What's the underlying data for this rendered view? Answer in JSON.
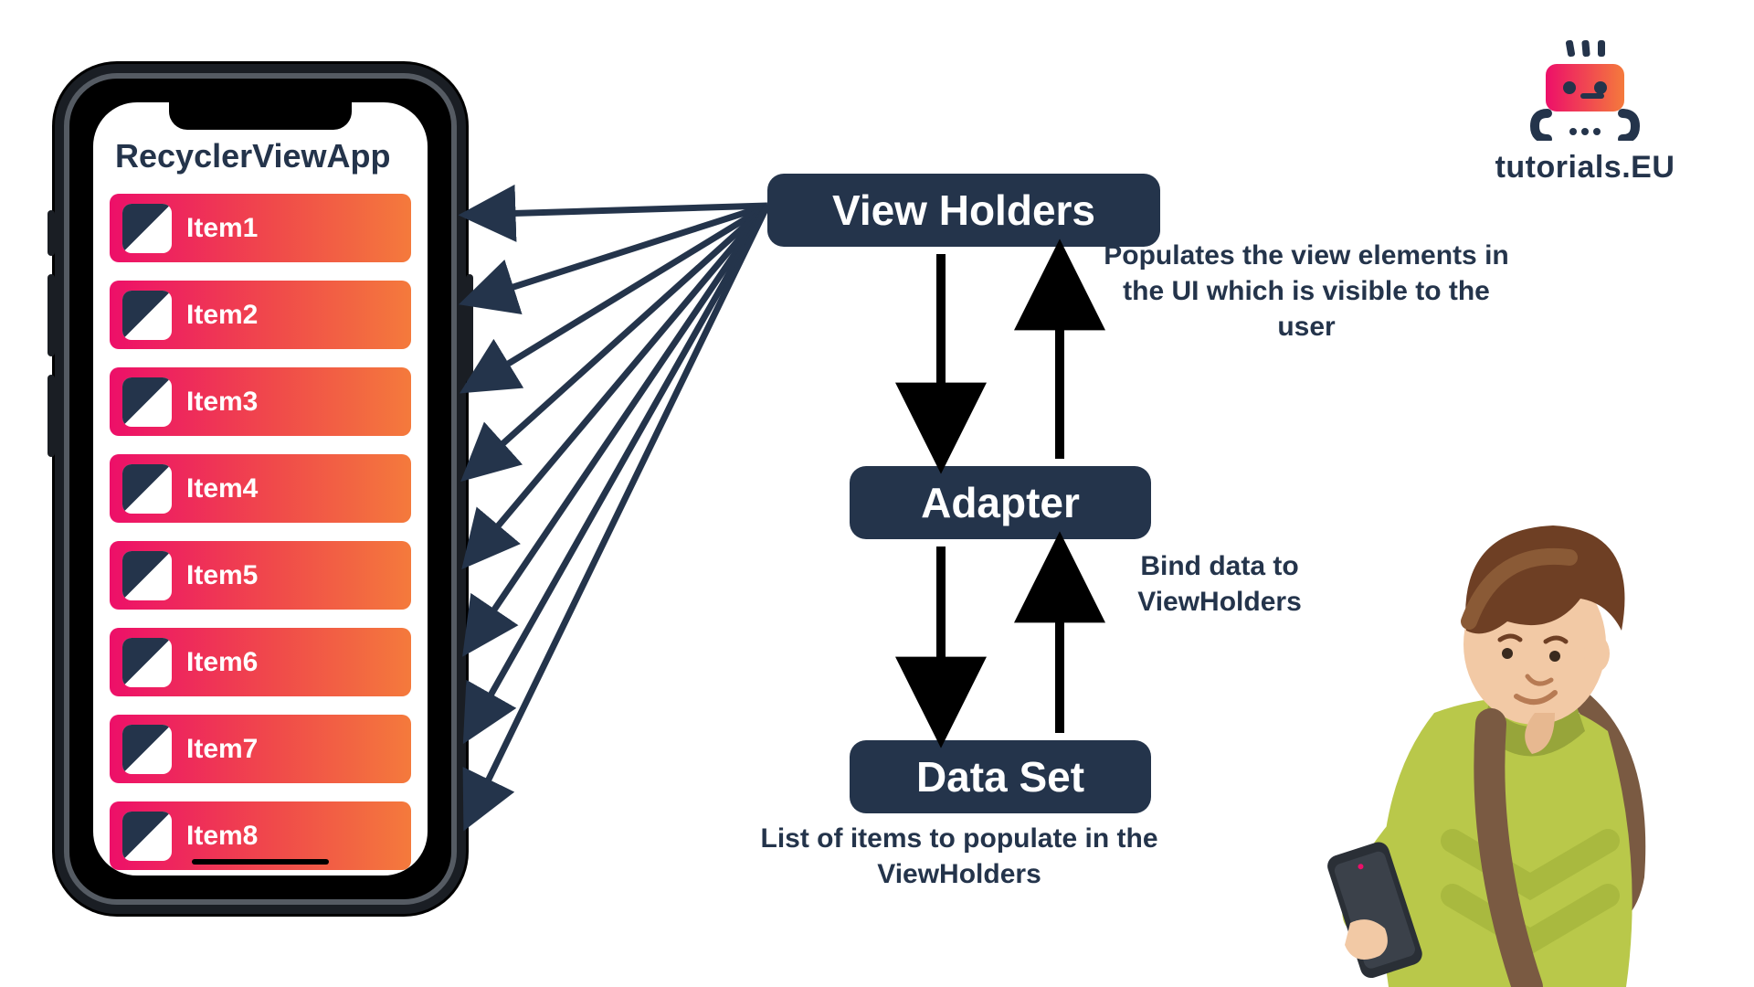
{
  "colors": {
    "navy": "#24344b",
    "itemGradientStart": "#ed0f69",
    "itemGradientMid": "#f04a4a",
    "itemGradientEnd": "#f47a3c"
  },
  "logo": {
    "text": "tutorials.EU"
  },
  "phone": {
    "appTitle": "RecyclerViewApp",
    "items": [
      {
        "label": "Item1"
      },
      {
        "label": "Item2"
      },
      {
        "label": "Item3"
      },
      {
        "label": "Item4"
      },
      {
        "label": "Item5"
      },
      {
        "label": "Item6"
      },
      {
        "label": "Item7"
      },
      {
        "label": "Item8"
      }
    ]
  },
  "nodes": {
    "viewHolders": {
      "title": "View Holders",
      "caption": "Populates the view elements in the UI which is visible to the user"
    },
    "adapter": {
      "title": "Adapter",
      "caption": "Bind data to ViewHolders"
    },
    "dataSet": {
      "title": "Data Set",
      "caption": "List of items to populate in the ViewHolders"
    }
  },
  "chart_data": {
    "type": "diagram",
    "title": "RecyclerView data flow",
    "nodes": [
      {
        "id": "viewholders",
        "label": "View Holders",
        "note": "Populates the view elements in the UI which is visible to the user"
      },
      {
        "id": "adapter",
        "label": "Adapter",
        "note": "Bind data to ViewHolders"
      },
      {
        "id": "dataset",
        "label": "Data Set",
        "note": "List of items to populate in the ViewHolders"
      },
      {
        "id": "item1",
        "label": "Item1"
      },
      {
        "id": "item2",
        "label": "Item2"
      },
      {
        "id": "item3",
        "label": "Item3"
      },
      {
        "id": "item4",
        "label": "Item4"
      },
      {
        "id": "item5",
        "label": "Item5"
      },
      {
        "id": "item6",
        "label": "Item6"
      },
      {
        "id": "item7",
        "label": "Item7"
      },
      {
        "id": "item8",
        "label": "Item8"
      }
    ],
    "edges": [
      {
        "from": "viewholders",
        "to": "item1"
      },
      {
        "from": "viewholders",
        "to": "item2"
      },
      {
        "from": "viewholders",
        "to": "item3"
      },
      {
        "from": "viewholders",
        "to": "item4"
      },
      {
        "from": "viewholders",
        "to": "item5"
      },
      {
        "from": "viewholders",
        "to": "item6"
      },
      {
        "from": "viewholders",
        "to": "item7"
      },
      {
        "from": "viewholders",
        "to": "item8"
      },
      {
        "from": "viewholders",
        "to": "adapter",
        "bidirectional": true
      },
      {
        "from": "adapter",
        "to": "dataset",
        "bidirectional": true
      }
    ]
  }
}
